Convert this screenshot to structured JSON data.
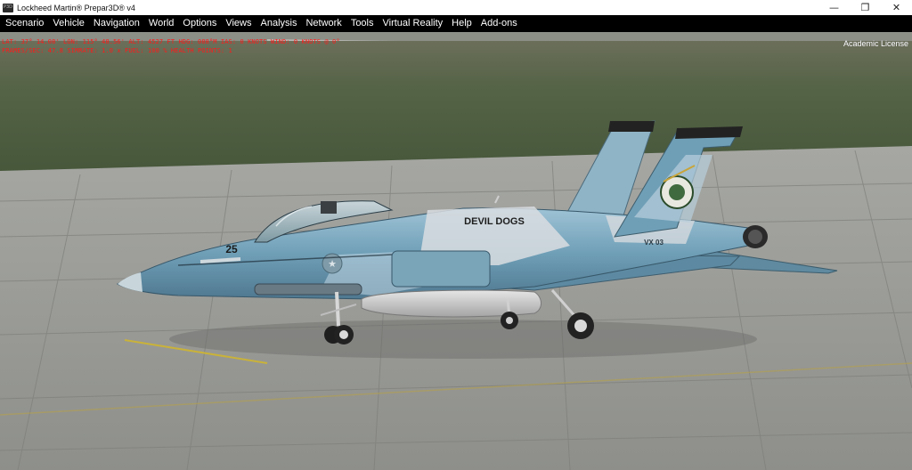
{
  "window": {
    "title": "Lockheed Martin® Prepar3D® v4",
    "icon_label": "P3D",
    "controls": {
      "minimize": "—",
      "restore": "❐",
      "close": "✕"
    }
  },
  "menu": [
    "Scenario",
    "Vehicle",
    "Navigation",
    "World",
    "Options",
    "Views",
    "Analysis",
    "Network",
    "Tools",
    "Virtual Reality",
    "Help",
    "Add-ons"
  ],
  "hud": {
    "line1": "LAT: 37° 14.08'  LON: 115° 48.56'  ALT: 4527 FT  HDG: 088°M  IAS: 0 KNOTS  WIND: 0 KNOTS @ 0°",
    "line2": "FRAMES/SEC: 47.8   SIMRATE: 1.0 x   FUEL: 100 %   HEALTH POINTS: 1"
  },
  "license_label": "Academic License",
  "aircraft": {
    "tail_text": "DEVIL DOGS",
    "nose_number": "25",
    "tail_code": "VX 03"
  },
  "colors": {
    "menubar": "#000000",
    "hud_text": "#ff1a1a",
    "grass": "#4c5c38",
    "tarmac": "#9c9d99",
    "aircraft_base": "#c8d2d8",
    "aircraft_camo": "#6b9bb2"
  }
}
